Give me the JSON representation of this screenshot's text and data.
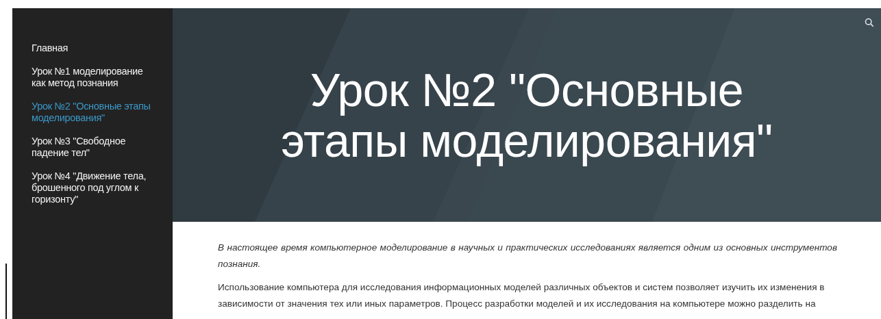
{
  "sidebar": {
    "items": [
      {
        "label": "Главная",
        "selected": false
      },
      {
        "label": "Урок №1 моделирование как метод познания",
        "selected": false
      },
      {
        "label": "Урок №2 \"Основные этапы моделирования\"",
        "selected": true
      },
      {
        "label": "Урок №3 \"Свободное падение тел\"",
        "selected": false
      },
      {
        "label": "Урок №4 \"Движение тела, брошенного под углом к горизонту\"",
        "selected": false
      }
    ]
  },
  "banner": {
    "title": "Урок №2 \"Основные этапы моделирования\""
  },
  "content": {
    "paragraphs": [
      {
        "kind": "intro",
        "text": "В настоящее время компьютерное моделирование в научных и практических исследованиях является одним из основных инструментов познания."
      },
      {
        "kind": "body",
        "text": "Использование компьютера для исследования информационных моделей различных объектов и систем позволяет изучить их изменения в зависимости от значения тех или иных параметров. Процесс разработки моделей и их исследования на компьютере можно разделить на"
      }
    ]
  }
}
